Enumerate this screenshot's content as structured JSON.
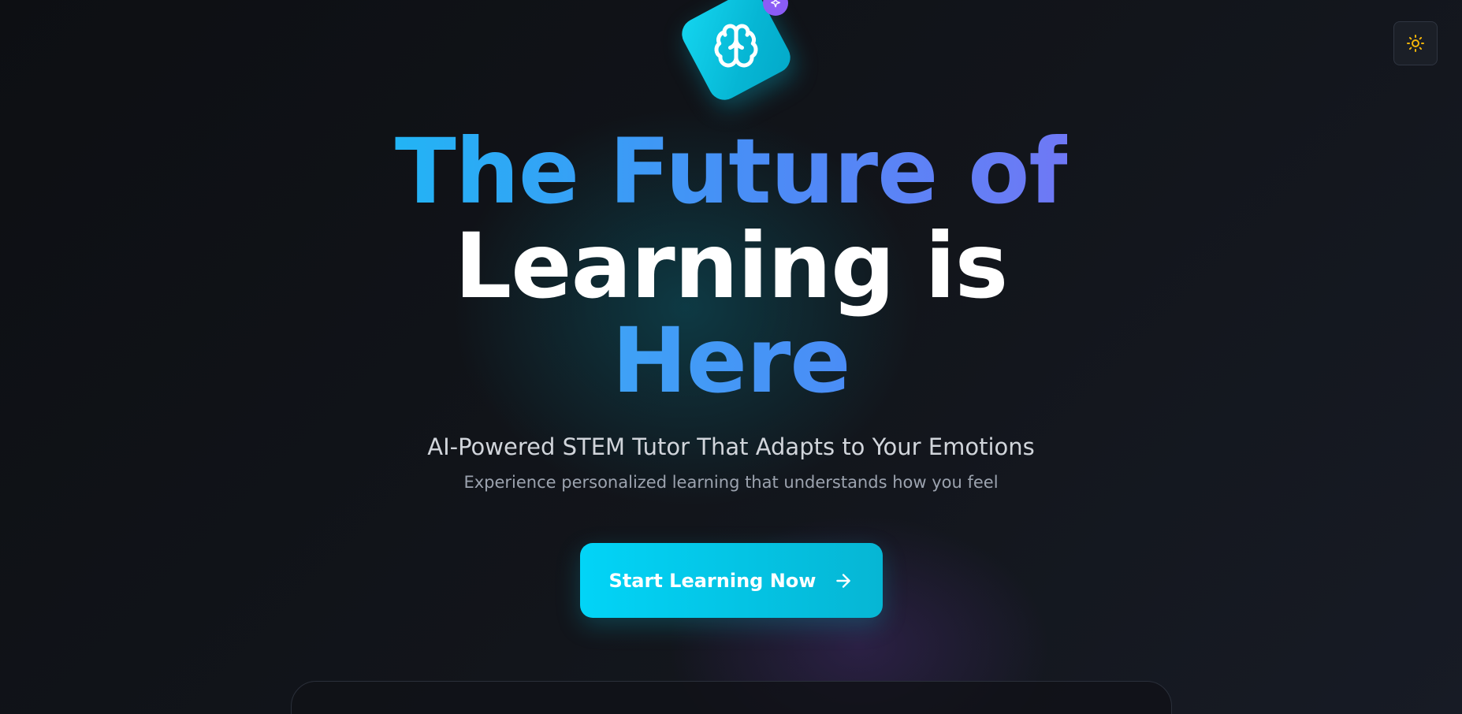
{
  "header": {
    "logo_icon": "brain-icon",
    "badge_icon": "sparkles-icon",
    "theme_toggle_icon": "sun-icon"
  },
  "hero": {
    "headline_line1": "The Future of",
    "headline_line2": "Learning is",
    "headline_line3": "Here",
    "subtitle": "AI-Powered STEM Tutor That Adapts to Your Emotions",
    "tagline": "Experience personalized learning that understands how you feel",
    "cta_label": "Start Learning Now",
    "cta_icon": "arrow-right-icon"
  },
  "colors": {
    "accent_cyan": "#06b6d4",
    "accent_blue": "#4b8cf6",
    "accent_violet": "#8b5cf6",
    "sun_yellow": "#f5b50a",
    "background": "#101217"
  }
}
